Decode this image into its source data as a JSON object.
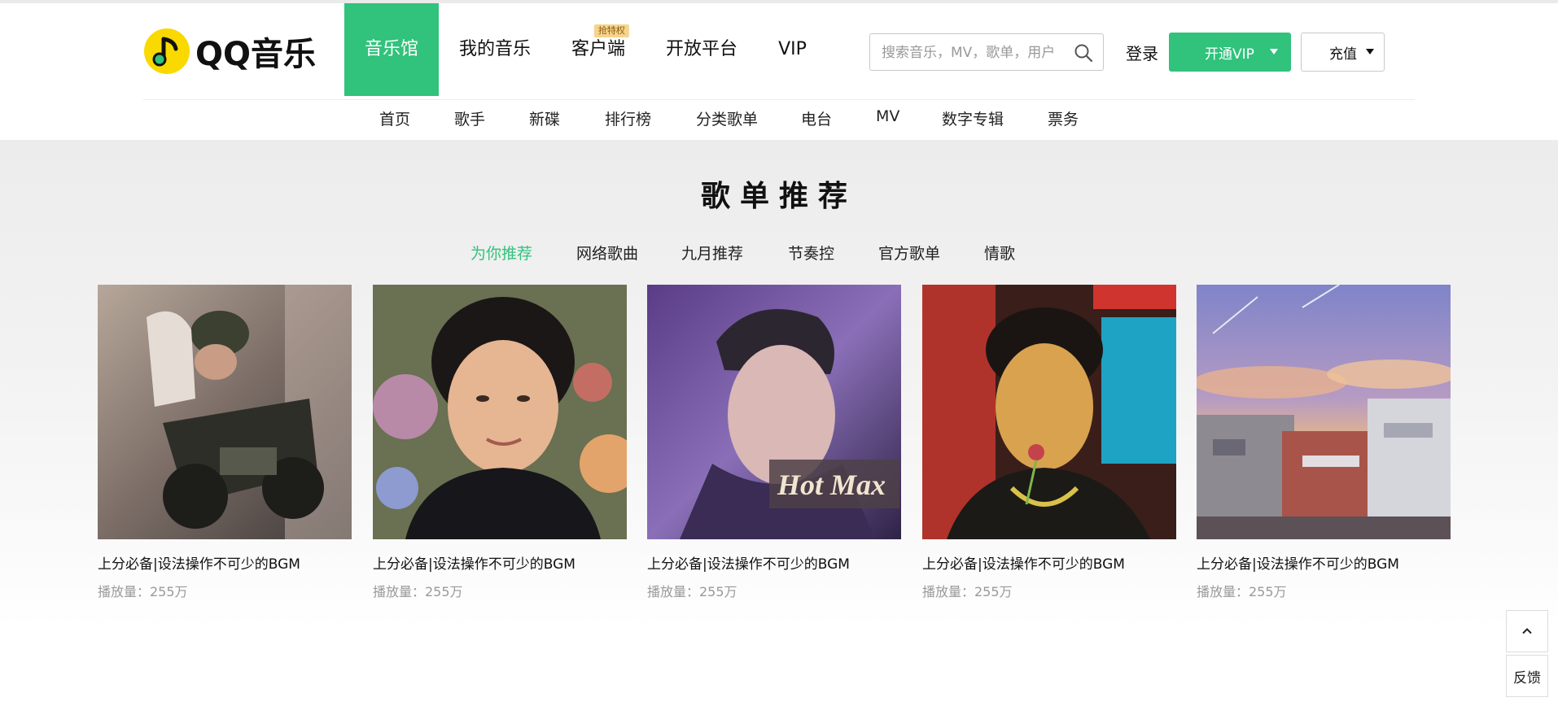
{
  "brand": {
    "name": "QQ音乐",
    "accent": "#31c27c"
  },
  "mainnav": [
    {
      "label": "音乐馆",
      "active": true
    },
    {
      "label": "我的音乐"
    },
    {
      "label": "客户端",
      "badge": "抢特权"
    },
    {
      "label": "开放平台"
    },
    {
      "label": "VIP"
    }
  ],
  "search": {
    "placeholder": "搜索音乐，MV，歌单，用户",
    "icon": "search-icon"
  },
  "user": {
    "login_label": "登录",
    "vip_label": "开通VIP",
    "recharge_label": "充值"
  },
  "subnav": [
    "首页",
    "歌手",
    "新碟",
    "排行榜",
    "分类歌单",
    "电台",
    "MV",
    "数字专辑",
    "票务"
  ],
  "section": {
    "title": "歌单推荐",
    "tabs": [
      "为你推荐",
      "网络歌曲",
      "九月推荐",
      "节奏控",
      "官方歌单",
      "情歌"
    ],
    "active_tab": "为你推荐"
  },
  "playlists": [
    {
      "title": "上分必备|设法操作不可少的BGM",
      "plays": "播放量：255万"
    },
    {
      "title": "上分必备|设法操作不可少的BGM",
      "plays": "播放量：255万"
    },
    {
      "title": "上分必备|设法操作不可少的BGM",
      "plays": "播放量：255万",
      "cover_text": "Hot Max"
    },
    {
      "title": "上分必备|设法操作不可少的BGM",
      "plays": "播放量：255万"
    },
    {
      "title": "上分必备|设法操作不可少的BGM",
      "plays": "播放量：255万"
    }
  ],
  "side_tools": {
    "top_icon": "chevron-up-icon",
    "feedback_label": "反馈"
  }
}
